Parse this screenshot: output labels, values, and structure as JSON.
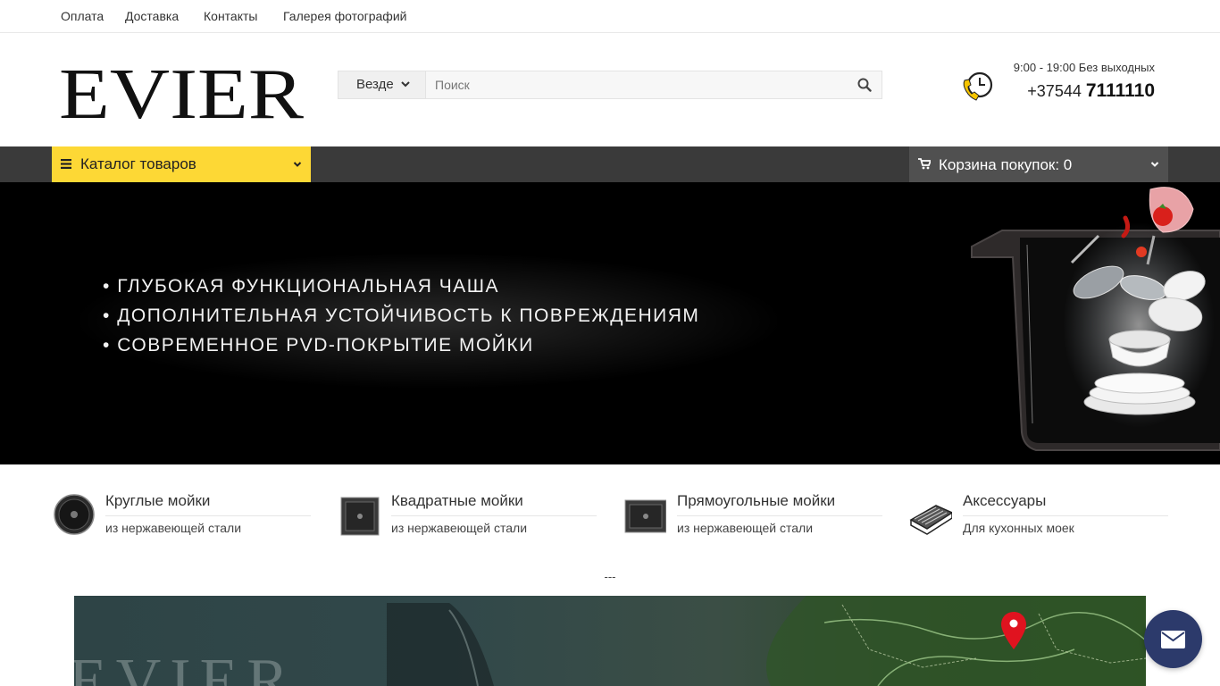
{
  "top_nav": [
    "Оплата",
    "Доставка",
    "Контакты",
    "Галерея фотографий"
  ],
  "logo_text": "EVIER",
  "search": {
    "scope": "Везде",
    "placeholder": "Поиск"
  },
  "contact": {
    "hours": "9:00 - 19:00 Без выходных",
    "phone_prefix": "+37544",
    "phone_number": "7111110"
  },
  "nav": {
    "catalog": "Каталог товаров",
    "cart": "Корзина покупок: 0"
  },
  "banner": {
    "bullets": [
      "ГЛУБОКАЯ ФУНКЦИОНАЛЬНАЯ ЧАША",
      "ДОПОЛНИТЕЛЬНАЯ УСТОЙЧИВОСТЬ К ПОВРЕЖДЕНИЯМ",
      "СОВРЕМЕННОЕ PVD-ПОКРЫТИЕ МОЙКИ"
    ]
  },
  "categories": [
    {
      "title": "Круглые мойки",
      "subtitle": "из нержавеющей стали"
    },
    {
      "title": "Квадратные мойки",
      "subtitle": "из нержавеющей стали"
    },
    {
      "title": "Прямоугольные мойки",
      "subtitle": "из нержавеющей стали"
    },
    {
      "title": "Аксессуары",
      "subtitle": "Для кухонных моек"
    }
  ],
  "separator": "---",
  "hero": {
    "brand": "EVIER"
  },
  "icons": {
    "phone": "phone-clock-icon",
    "search": "search-icon",
    "catalog": "hamburger-icon",
    "cart": "cart-icon",
    "chevron": "chevron-down-icon",
    "mail": "mail-icon",
    "map": "map-pin-icon"
  },
  "colors": {
    "accent": "#fdd835",
    "navbar": "#3a3a3a",
    "cart_bg": "#505050",
    "mail_button": "#2c3a6b",
    "map_pin": "#e0131f"
  }
}
